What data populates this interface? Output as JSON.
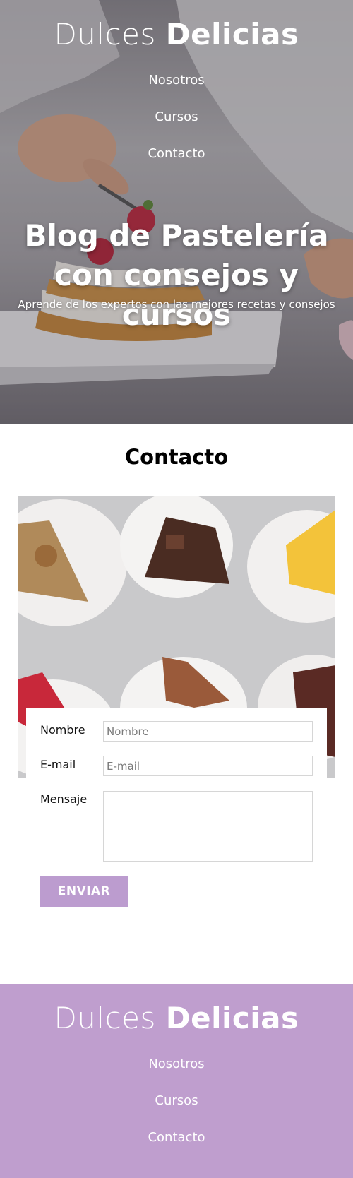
{
  "brand": {
    "name_light": "Dulces ",
    "name_bold": "Delicias"
  },
  "nav": {
    "items": [
      "Nosotros",
      "Cursos",
      "Contacto"
    ]
  },
  "hero": {
    "title": "Blog de Pastelería con consejos y cursos",
    "subtitle": "Aprende de los expertos con las mejores recetas y consejos"
  },
  "contact": {
    "title": "Contacto",
    "name_label": "Nombre",
    "name_placeholder": "Nombre",
    "email_label": "E-mail",
    "email_placeholder": "E-mail",
    "message_label": "Mensaje",
    "send_label": "ENVIAR"
  },
  "colors": {
    "accent": "#bc9ccf",
    "footer": "#bf9ece"
  }
}
